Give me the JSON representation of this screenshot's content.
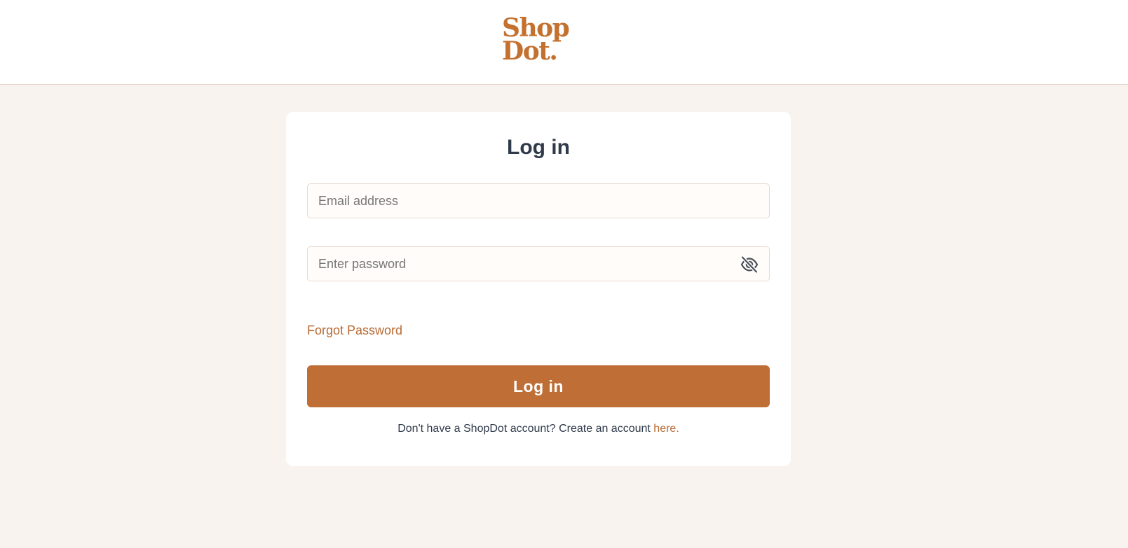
{
  "brand": {
    "logo_line1": "Shop",
    "logo_line2": "Dot",
    "logo_dot": ".",
    "color": "#c4712f"
  },
  "login": {
    "title": "Log in",
    "email": {
      "value": "",
      "placeholder": "Email address"
    },
    "password": {
      "value": "",
      "placeholder": "Enter password",
      "toggle_icon": "eye-off-icon"
    },
    "forgot_password": "Forgot Password",
    "submit_label": "Log in",
    "signup_prompt": "Don't have a ShopDot account? Create an account",
    "signup_link": "here."
  },
  "colors": {
    "accent": "#bf6e35",
    "link": "#b86b34",
    "background": "#f8f3ee",
    "heading": "#2f3a4a"
  }
}
